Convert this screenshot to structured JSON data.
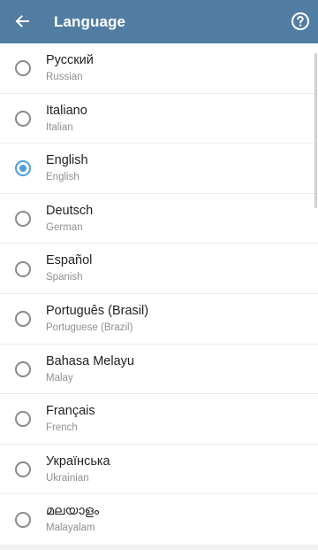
{
  "appbar": {
    "title": "Language",
    "back_icon": "arrow-left-icon",
    "help_icon": "help-circle-icon",
    "background": "#527da3"
  },
  "languages": [
    {
      "label": "Русский",
      "sublabel": "Russian",
      "selected": false
    },
    {
      "label": "Italiano",
      "sublabel": "Italian",
      "selected": false
    },
    {
      "label": "English",
      "sublabel": "English",
      "selected": true
    },
    {
      "label": "Deutsch",
      "sublabel": "German",
      "selected": false
    },
    {
      "label": "Español",
      "sublabel": "Spanish",
      "selected": false
    },
    {
      "label": "Português (Brasil)",
      "sublabel": "Portuguese (Brazil)",
      "selected": false
    },
    {
      "label": "Bahasa Melayu",
      "sublabel": "Malay",
      "selected": false
    },
    {
      "label": "Français",
      "sublabel": "French",
      "selected": false
    },
    {
      "label": "Українська",
      "sublabel": "Ukrainian",
      "selected": false
    },
    {
      "label": "മലയാളം",
      "sublabel": "Malayalam",
      "selected": false
    }
  ],
  "accent_color": "#4a9fe0"
}
